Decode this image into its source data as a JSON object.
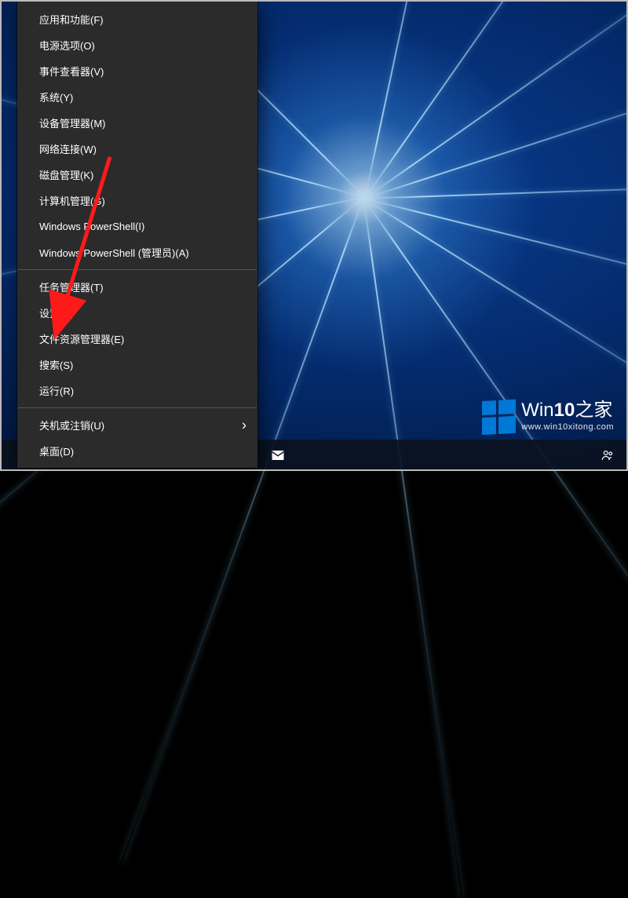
{
  "menu": {
    "groups": [
      [
        {
          "id": "apps-features",
          "label": "应用和功能(F)"
        },
        {
          "id": "power-options",
          "label": "电源选项(O)"
        },
        {
          "id": "event-viewer",
          "label": "事件查看器(V)"
        },
        {
          "id": "system",
          "label": "系统(Y)"
        },
        {
          "id": "device-manager",
          "label": "设备管理器(M)"
        },
        {
          "id": "network-connections",
          "label": "网络连接(W)"
        },
        {
          "id": "disk-management",
          "label": "磁盘管理(K)"
        },
        {
          "id": "computer-management",
          "label": "计算机管理(G)"
        },
        {
          "id": "powershell",
          "label": "Windows PowerShell(I)"
        },
        {
          "id": "powershell-admin",
          "label": "Windows PowerShell (管理员)(A)"
        }
      ],
      [
        {
          "id": "task-manager",
          "label": "任务管理器(T)"
        },
        {
          "id": "settings",
          "label": "设置(N)"
        },
        {
          "id": "file-explorer",
          "label": "文件资源管理器(E)"
        },
        {
          "id": "search",
          "label": "搜索(S)"
        },
        {
          "id": "run",
          "label": "运行(R)"
        }
      ],
      [
        {
          "id": "shutdown-signout",
          "label": "关机或注销(U)",
          "submenu": true
        },
        {
          "id": "desktop",
          "label": "桌面(D)"
        }
      ]
    ]
  },
  "watermark": {
    "brand_prefix": "Win",
    "brand_bold": "10",
    "brand_suffix": "之家",
    "url": "www.win10xitong.com"
  },
  "colors": {
    "menu_bg": "#2b2b2b",
    "accent": "#0078d7",
    "arrow": "#ff1a1a"
  }
}
